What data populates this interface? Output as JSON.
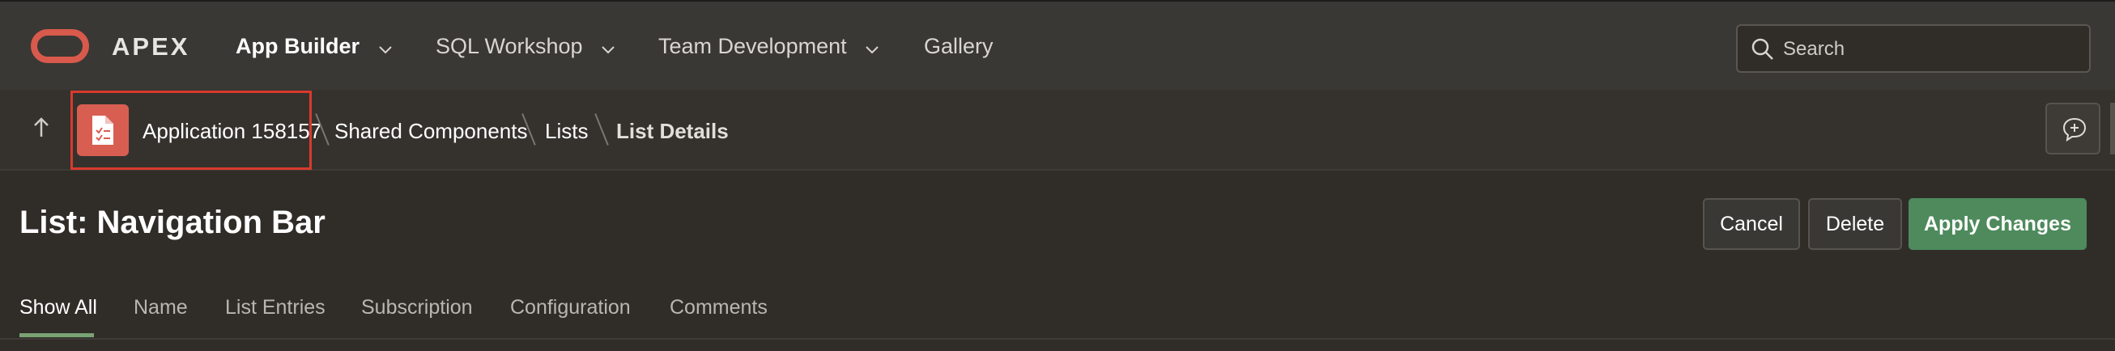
{
  "topbar": {
    "brand": "APEX",
    "nav": [
      {
        "label": "App Builder",
        "active": true
      },
      {
        "label": "SQL Workshop",
        "active": false
      },
      {
        "label": "Team Development",
        "active": false
      },
      {
        "label": "Gallery",
        "active": false
      }
    ],
    "search_placeholder": "Search"
  },
  "breadcrumb": {
    "items": [
      "Application 158157",
      "Shared Components",
      "Lists",
      "List Details"
    ]
  },
  "page": {
    "title": "List: Navigation Bar",
    "buttons": {
      "cancel": "Cancel",
      "delete": "Delete",
      "apply": "Apply Changes"
    }
  },
  "tabs": [
    "Show All",
    "Name",
    "List Entries",
    "Subscription",
    "Configuration",
    "Comments"
  ],
  "colors": {
    "accent_red": "#d95e52",
    "primary_green": "#4e8a5c",
    "highlight_red": "#d83a2c",
    "active_tab_underline": "#7aa374"
  },
  "icons": [
    "oracle-logo",
    "chevron-down-icon",
    "search-icon",
    "up-arrow-icon",
    "application-icon",
    "feedback-icon"
  ]
}
